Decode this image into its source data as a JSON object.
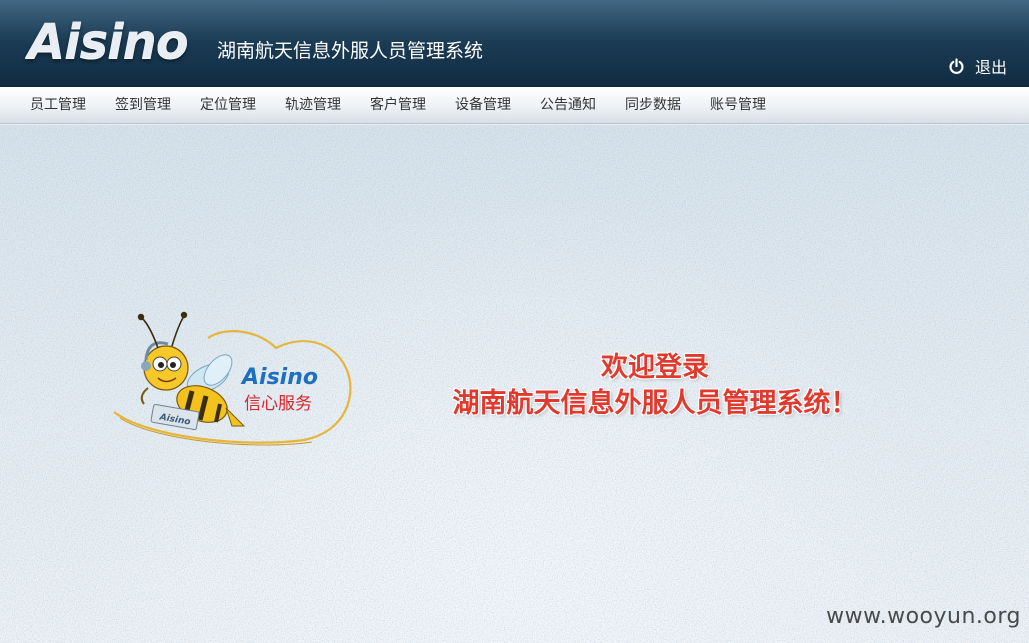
{
  "header": {
    "logo_text": "Aisino",
    "app_title": "湖南航天信息外服人员管理系统",
    "logout_label": "退出",
    "logout_icon": "power-icon"
  },
  "nav": {
    "items": [
      {
        "label": "员工管理"
      },
      {
        "label": "签到管理"
      },
      {
        "label": "定位管理"
      },
      {
        "label": "轨迹管理"
      },
      {
        "label": "客户管理"
      },
      {
        "label": "设备管理"
      },
      {
        "label": "公告通知"
      },
      {
        "label": "同步数据"
      },
      {
        "label": "账号管理"
      }
    ]
  },
  "main": {
    "mascot": {
      "brand_text": "Aisino",
      "slogan_text": "信心服务",
      "badge_text": "Aisino"
    },
    "welcome_line1": "欢迎登录",
    "welcome_line2": "湖南航天信息外服人员管理系统！"
  },
  "watermark": "www.wooyun.org",
  "colors": {
    "header_bg": "#1c3e58",
    "welcome_text": "#e03a2e",
    "brand_blue": "#1e6fbf",
    "slogan_red": "#d6262c"
  }
}
